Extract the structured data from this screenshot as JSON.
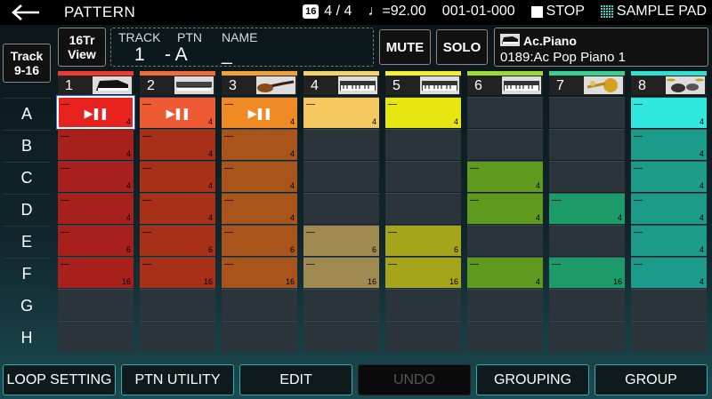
{
  "header": {
    "title": "PATTERN",
    "badge": "16",
    "time_signature": "4 / 4",
    "tempo": "♩=92.00",
    "position": "001-01-000",
    "transport_state": "STOP",
    "mode": "SAMPLE PAD"
  },
  "buttons": {
    "track_view": "Track 9-16",
    "tr_view": "16Tr View",
    "mute": "MUTE",
    "solo": "SOLO"
  },
  "info": {
    "track_label": "TRACK",
    "ptn_label": "PTN",
    "name_label": "NAME",
    "track_value": "1",
    "ptn_value": "- A",
    "name_value": "_"
  },
  "tone": {
    "category": "Ac.Piano",
    "name": "0189:Ac Pop Piano 1"
  },
  "rows": [
    "A",
    "B",
    "C",
    "D",
    "E",
    "F",
    "G",
    "H"
  ],
  "tracks": [
    {
      "num": "1",
      "color": "#ee3a30",
      "cell_color": "#a8201c",
      "active_color": "#e8221e",
      "instrument": "piano-icon"
    },
    {
      "num": "2",
      "color": "#f06a3c",
      "cell_color": "#a83018",
      "active_color": "#ee5a34",
      "instrument": "epiano-icon"
    },
    {
      "num": "3",
      "color": "#f2a23a",
      "cell_color": "#a8541a",
      "active_color": "#ef8a24",
      "instrument": "bass-guitar-icon"
    },
    {
      "num": "4",
      "color": "#f6d26a",
      "cell_color": "#a08a52",
      "active_color": "#f6c860",
      "instrument": "synth-keyboard-icon"
    },
    {
      "num": "5",
      "color": "#f4f02a",
      "cell_color": "#a6a41a",
      "active_color": "#e8e610",
      "instrument": "synth-keyboard-icon"
    },
    {
      "num": "6",
      "color": "#a0d83a",
      "cell_color": "#5f9a1e",
      "active_color": "#8ed030",
      "instrument": "synth-keyboard-icon"
    },
    {
      "num": "7",
      "color": "#3ad090",
      "cell_color": "#1c9a6a",
      "active_color": "#30c888",
      "instrument": "brass-icon"
    },
    {
      "num": "8",
      "color": "#30e0d0",
      "cell_color": "#1c9a8a",
      "active_color": "#30e8e0",
      "instrument": "drum-kit-icon"
    }
  ],
  "grid": [
    [
      {
        "len": "4",
        "active": true
      },
      {
        "len": "4"
      },
      {
        "len": "4"
      },
      {
        "len": "4"
      },
      {
        "len": "4"
      },
      {
        "len": "4"
      },
      {
        "len": "4"
      },
      {
        "len": "6"
      },
      {
        "len": "16"
      },
      null
    ],
    [
      {
        "len": "4",
        "active": true
      },
      {
        "len": "4"
      },
      {
        "len": "4"
      },
      {
        "len": "4"
      },
      {
        "len": "6"
      },
      {
        "len": "16"
      }
    ],
    [
      {
        "len": "4",
        "active": true
      },
      {
        "len": "4"
      },
      {
        "len": "4"
      },
      {
        "len": "4"
      },
      {
        "len": "6"
      },
      {
        "len": "16"
      }
    ],
    [
      {
        "len": "4",
        "active": true
      },
      null,
      null,
      null,
      {
        "len": "6"
      },
      {
        "len": "16"
      }
    ],
    [
      {
        "len": "4",
        "active": true
      },
      null,
      null,
      null,
      {
        "len": "6"
      },
      {
        "len": "16"
      }
    ],
    [
      null,
      null,
      {
        "len": "4"
      },
      {
        "len": "4"
      },
      null,
      {
        "len": "4"
      }
    ],
    [
      null,
      null,
      null,
      {
        "len": "4"
      },
      null,
      {
        "len": "16"
      }
    ],
    [
      {
        "len": "4",
        "active": true
      },
      {
        "len": "4"
      },
      {
        "len": "4"
      },
      {
        "len": "4"
      },
      {
        "len": "4"
      },
      {
        "len": "4"
      }
    ]
  ],
  "play_symbol": "▶❚❚",
  "footer": [
    "LOOP SETTING",
    "PTN UTILITY",
    "EDIT",
    "UNDO",
    "GROUPING",
    "GROUP"
  ],
  "footer_disabled_index": 3
}
